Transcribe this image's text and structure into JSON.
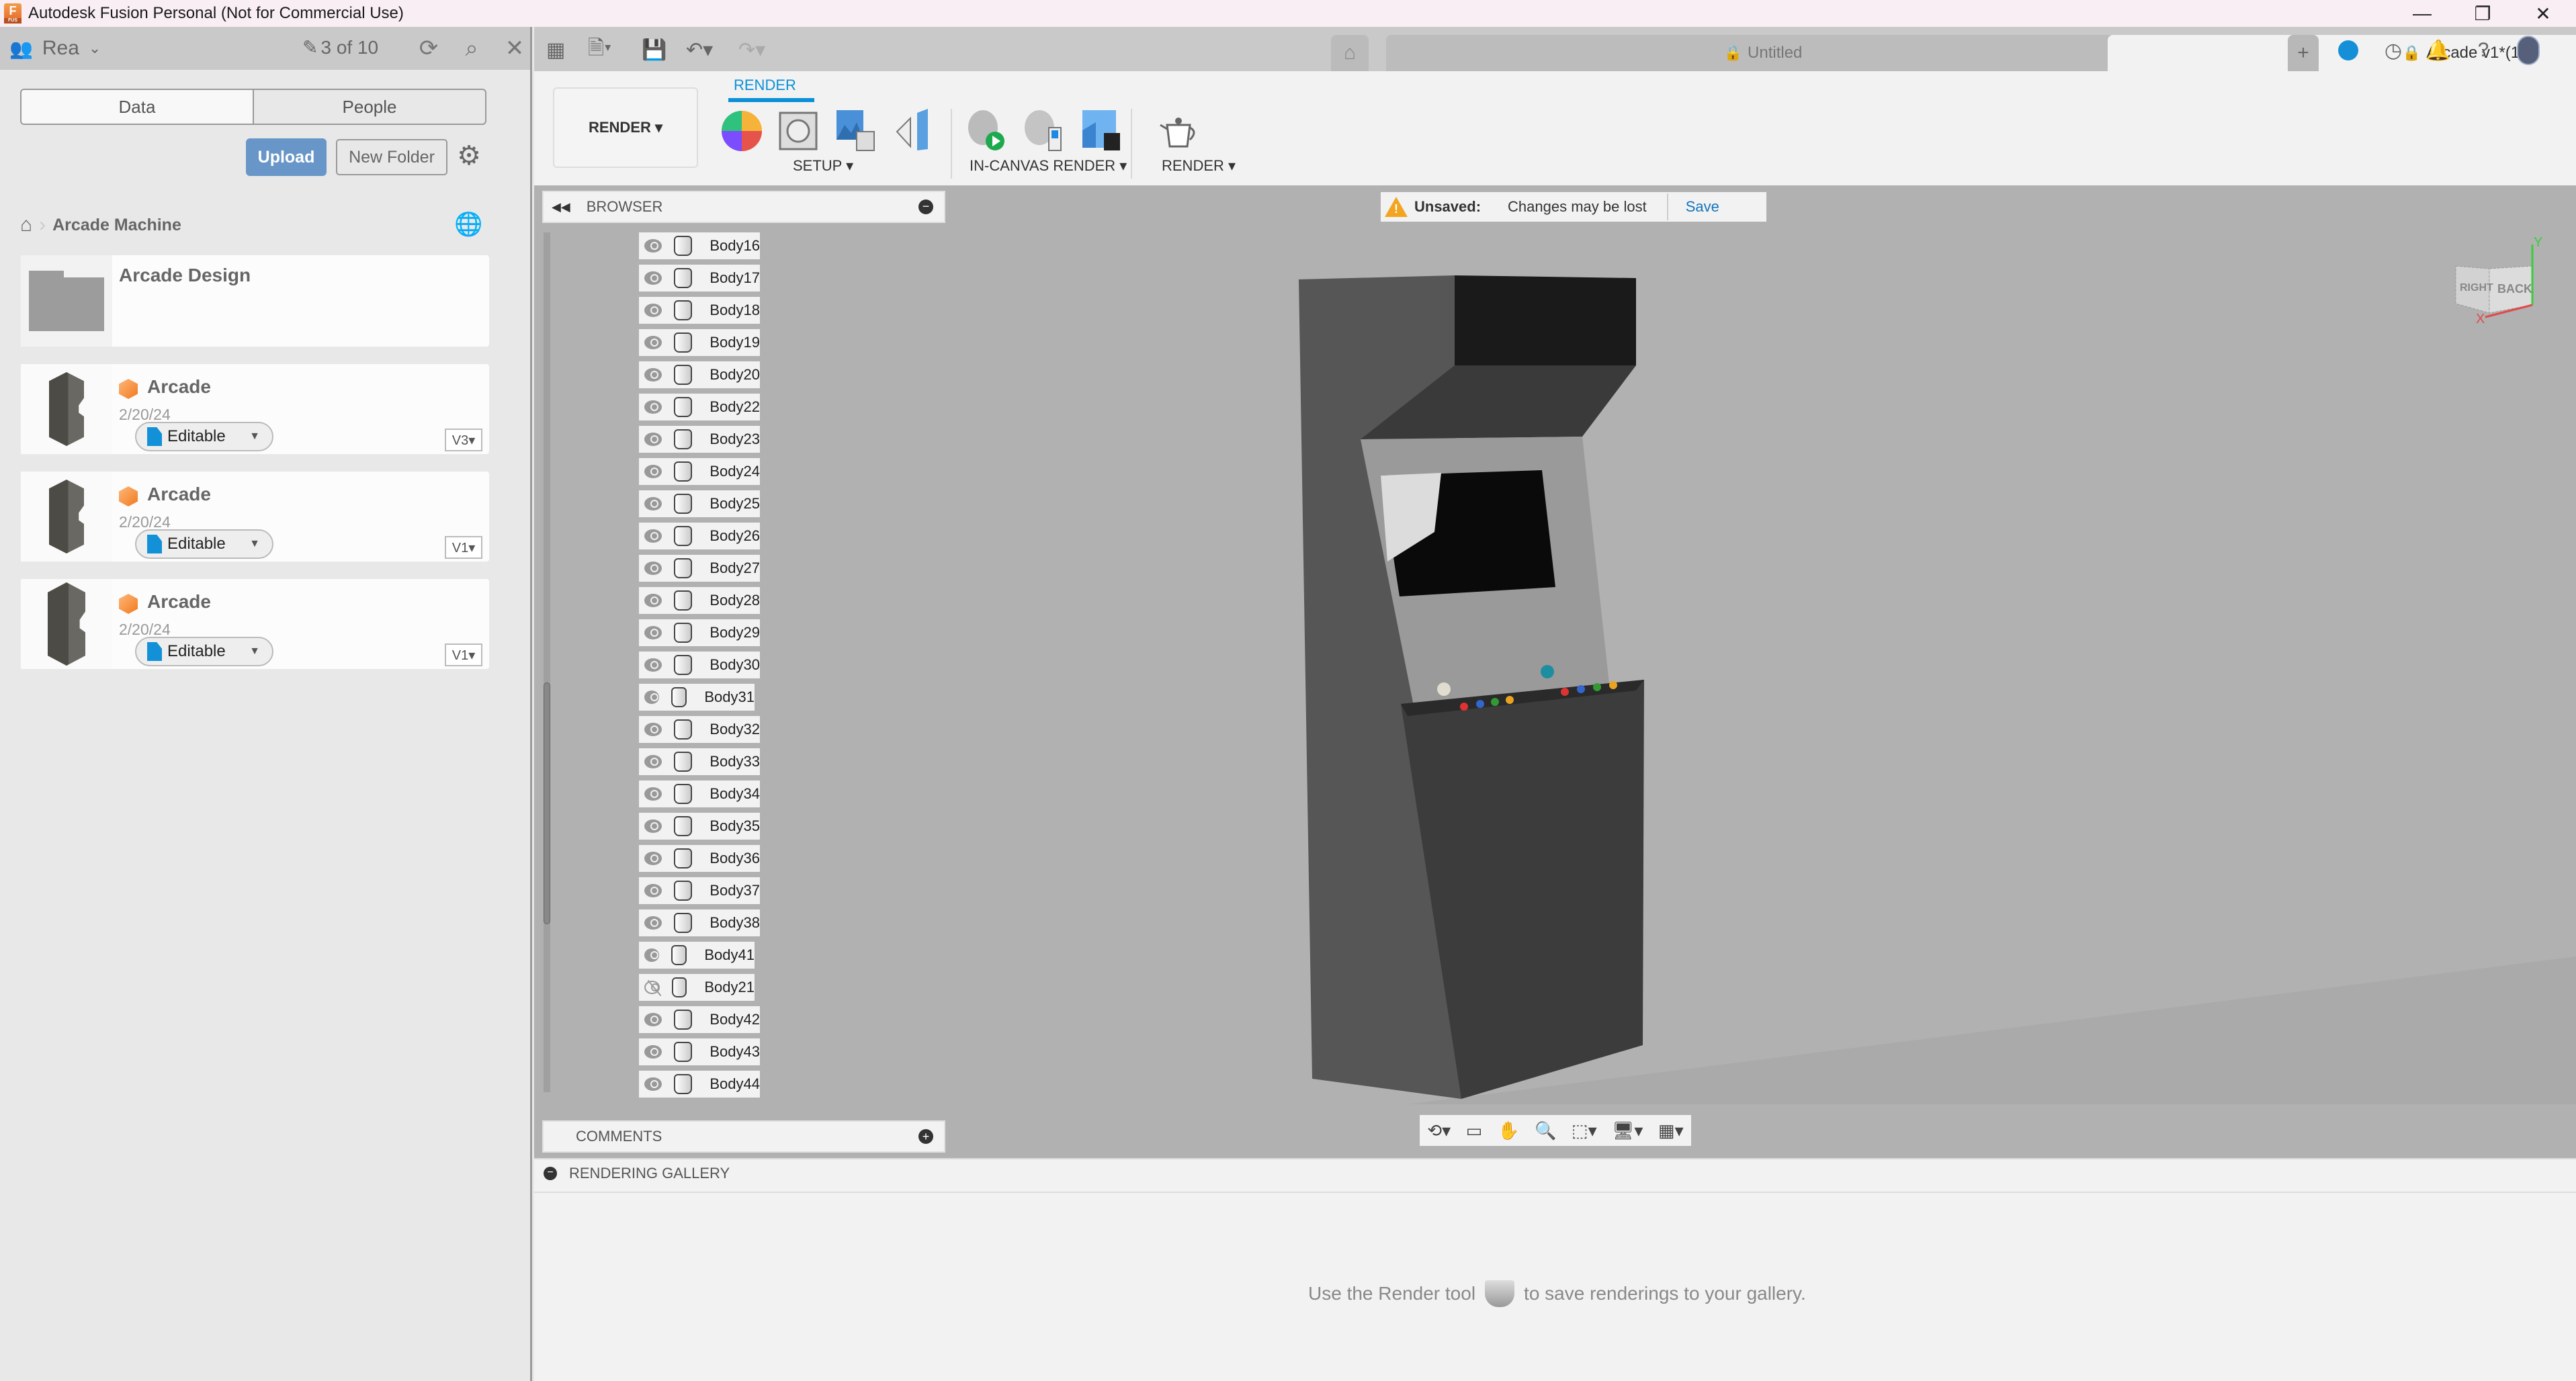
{
  "window": {
    "title": "Autodesk Fusion Personal (Not for Commercial Use)",
    "app_icon_letter": "F",
    "app_icon_sub": "FUS",
    "minimize_glyph": "—",
    "restore_glyph": "❐",
    "close_glyph": "✕"
  },
  "data_panel": {
    "team_name": "Rea",
    "doc_count": "3 of 10",
    "tabs": [
      {
        "label": "Data",
        "active": true
      },
      {
        "label": "People",
        "active": false
      }
    ],
    "upload_label": "Upload",
    "new_folder_label": "New Folder",
    "breadcrumb": {
      "current": "Arcade Machine"
    },
    "folder": {
      "name": "Arcade Design"
    },
    "designs": [
      {
        "name": "Arcade",
        "date": "2/20/24",
        "status": "Editable",
        "version": "V3▾"
      },
      {
        "name": "Arcade",
        "date": "2/20/24",
        "status": "Editable",
        "version": "V1▾"
      },
      {
        "name": "Arcade",
        "date": "2/20/24",
        "status": "Editable",
        "version": "V1▾"
      }
    ]
  },
  "doc_tabs": [
    {
      "label": "Untitled",
      "active": false
    },
    {
      "label": "Arcade v1*(1)",
      "active": true
    }
  ],
  "ribbon": {
    "workspace_label": "RENDER ▾",
    "active_tab": "RENDER",
    "groups": [
      {
        "label": "SETUP ▾"
      },
      {
        "label": "IN-CANVAS RENDER ▾"
      },
      {
        "label": "RENDER ▾"
      }
    ]
  },
  "browser": {
    "title": "BROWSER",
    "bodies": [
      {
        "name": "Body16",
        "visible": true
      },
      {
        "name": "Body17",
        "visible": true
      },
      {
        "name": "Body18",
        "visible": true
      },
      {
        "name": "Body19",
        "visible": true
      },
      {
        "name": "Body20",
        "visible": true
      },
      {
        "name": "Body22",
        "visible": true
      },
      {
        "name": "Body23",
        "visible": true
      },
      {
        "name": "Body24",
        "visible": true
      },
      {
        "name": "Body25",
        "visible": true
      },
      {
        "name": "Body26",
        "visible": true
      },
      {
        "name": "Body27",
        "visible": true
      },
      {
        "name": "Body28",
        "visible": true
      },
      {
        "name": "Body29",
        "visible": true
      },
      {
        "name": "Body30",
        "visible": true
      },
      {
        "name": "Body31",
        "visible": true
      },
      {
        "name": "Body32",
        "visible": true
      },
      {
        "name": "Body33",
        "visible": true
      },
      {
        "name": "Body34",
        "visible": true
      },
      {
        "name": "Body35",
        "visible": true
      },
      {
        "name": "Body36",
        "visible": true
      },
      {
        "name": "Body37",
        "visible": true
      },
      {
        "name": "Body38",
        "visible": true
      },
      {
        "name": "Body41",
        "visible": true
      },
      {
        "name": "Body21",
        "visible": false
      },
      {
        "name": "Body42",
        "visible": true
      },
      {
        "name": "Body43",
        "visible": true
      },
      {
        "name": "Body44",
        "visible": true
      }
    ]
  },
  "comments": {
    "title": "COMMENTS"
  },
  "unsaved_banner": {
    "label": "Unsaved:",
    "message": "Changes may be lost",
    "action": "Save"
  },
  "viewcube": {
    "face_left": "RIGHT",
    "face_right": "BACK",
    "axis_x": "X",
    "axis_y": "Y"
  },
  "gallery": {
    "title": "RENDERING GALLERY",
    "message_before": "Use the Render tool",
    "message_after": "to save renderings to your gallery."
  }
}
